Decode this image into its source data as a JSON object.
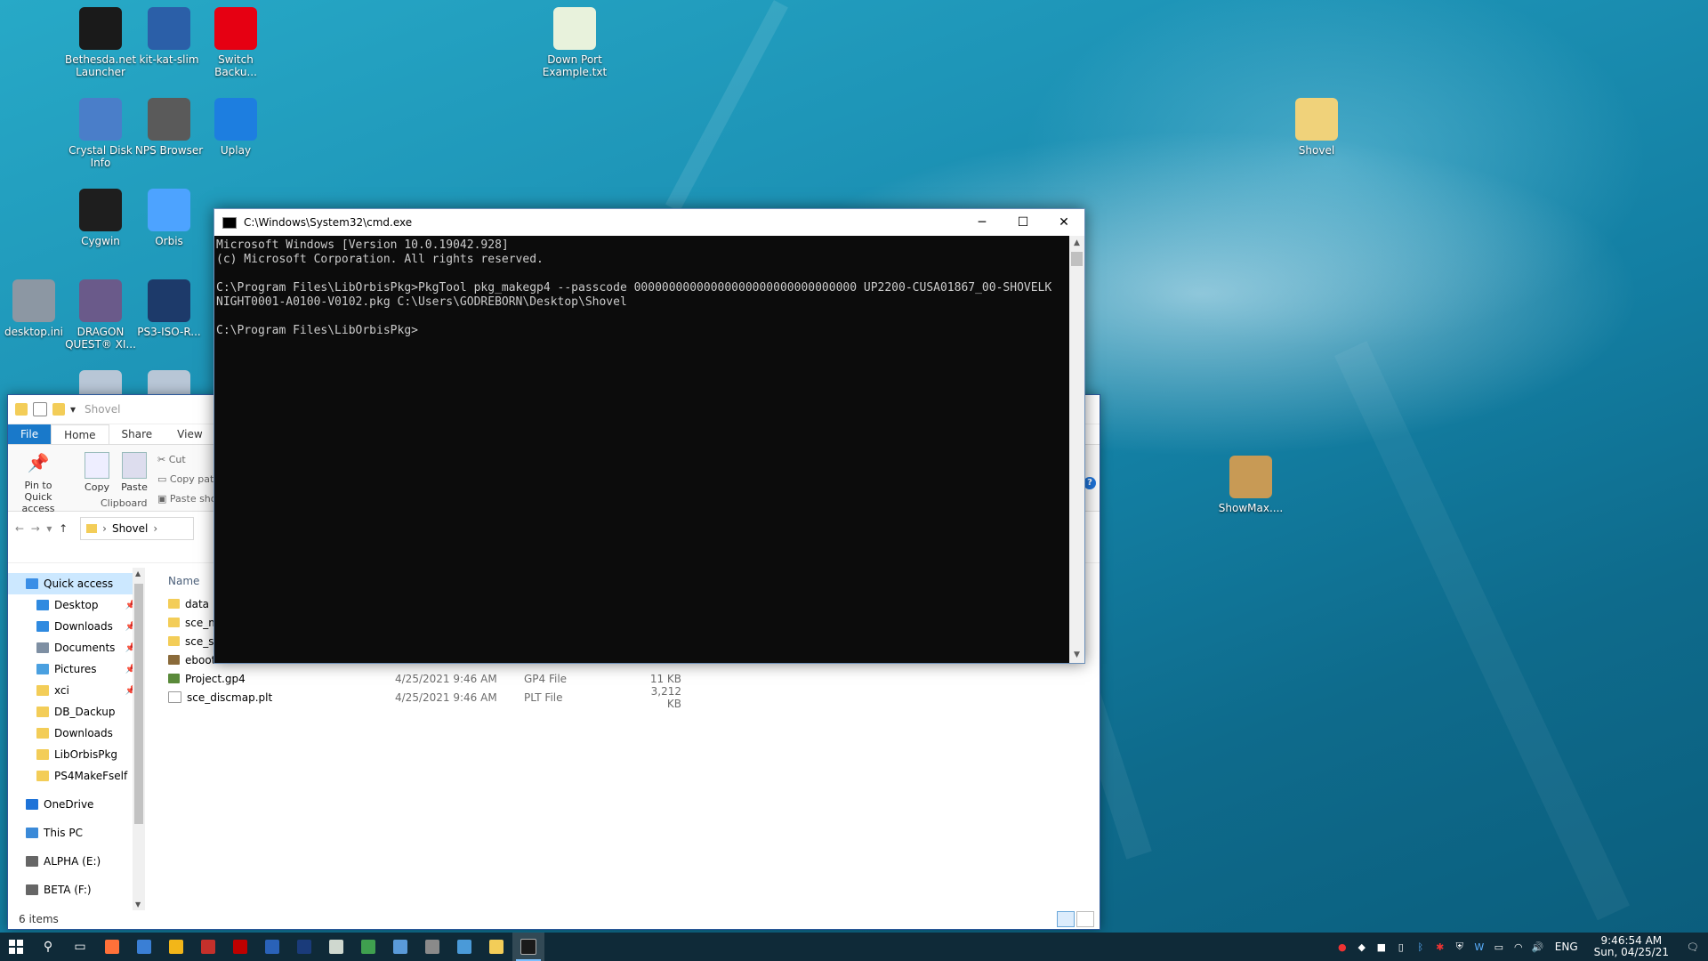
{
  "desktop": {
    "icons": [
      {
        "label": "Bethesda.net Launcher",
        "color": "#1a1a1a",
        "icon": "bethesda-icon"
      },
      {
        "label": "kit-kat-slim",
        "color": "#2b5fa8",
        "icon": "laptop-icon"
      },
      {
        "label": "Switch Backu...",
        "color": "#e60012",
        "icon": "switch-icon"
      },
      {
        "label": "Down Port Example.txt",
        "color": "#e8f2dc",
        "icon": "notepad-icon"
      },
      {
        "label": "Crystal Disk Info",
        "color": "#4a7ec9",
        "icon": "disk-icon"
      },
      {
        "label": "NPS Browser",
        "color": "#5a5a5a",
        "icon": "nps-icon"
      },
      {
        "label": "Uplay",
        "color": "#1d7ee0",
        "icon": "uplay-icon"
      },
      {
        "label": "Shovel",
        "color": "#f0d27a",
        "icon": "folder-icon"
      },
      {
        "label": "Cygwin",
        "color": "#1e1e1e",
        "icon": "cygwin-icon"
      },
      {
        "label": "Orbis",
        "color": "#4da3ff",
        "icon": "orbis-icon"
      },
      {
        "label": "desktop.ini",
        "color": "#8c97a3",
        "icon": "settings-file-icon"
      },
      {
        "label": "DRAGON QUEST® XI...",
        "color": "#6a5a8a",
        "icon": "game-icon"
      },
      {
        "label": "PS3-ISO-R...",
        "color": "#1d3a6a",
        "icon": "disc-icon"
      },
      {
        "label": "ShowMax....",
        "color": "#c89a55",
        "icon": "package-icon"
      }
    ]
  },
  "cmd": {
    "title": "C:\\Windows\\System32\\cmd.exe",
    "lines": [
      "Microsoft Windows [Version 10.0.19042.928]",
      "(c) Microsoft Corporation. All rights reserved.",
      "",
      "C:\\Program Files\\LibOrbisPkg>PkgTool pkg_makegp4 --passcode 00000000000000000000000000000000 UP2200-CUSA01867_00-SHOVELK",
      "NIGHT0001-A0100-V0102.pkg C:\\Users\\GODREBORN\\Desktop\\Shovel",
      "",
      "C:\\Program Files\\LibOrbisPkg>"
    ]
  },
  "explorer": {
    "title": "Shovel",
    "tabs": [
      "File",
      "Home",
      "Share",
      "View"
    ],
    "ribbon": {
      "pin": "Pin to Quick access",
      "copy": "Copy",
      "paste": "Paste",
      "cut": "Cut",
      "copy_path": "Copy path",
      "paste_shortcut": "Paste shor",
      "group": "Clipboard"
    },
    "breadcrumb": "Shovel",
    "column_name": "Name",
    "nav": [
      {
        "label": "Quick access",
        "color": "#3a8ee6",
        "pinned": false
      },
      {
        "label": "Desktop",
        "color": "#2f8ae0",
        "pinned": true
      },
      {
        "label": "Downloads",
        "color": "#2f8ae0",
        "pinned": true
      },
      {
        "label": "Documents",
        "color": "#7e8fa3",
        "pinned": true
      },
      {
        "label": "Pictures",
        "color": "#4aa0e0",
        "pinned": true
      },
      {
        "label": "xci",
        "color": "#f3cd58",
        "pinned": true
      },
      {
        "label": "DB_Dackup",
        "color": "#f3cd58",
        "pinned": false
      },
      {
        "label": "Downloads",
        "color": "#f3cd58",
        "pinned": false
      },
      {
        "label": "LibOrbisPkg",
        "color": "#f3cd58",
        "pinned": false
      },
      {
        "label": "PS4MakeFself",
        "color": "#f3cd58",
        "pinned": false
      },
      {
        "label": "OneDrive",
        "color": "#1e73d8",
        "pinned": false
      },
      {
        "label": "This PC",
        "color": "#3b8ad8",
        "pinned": false
      },
      {
        "label": "ALPHA (E:)",
        "color": "#666666",
        "pinned": false
      },
      {
        "label": "BETA (F:)",
        "color": "#666666",
        "pinned": false
      }
    ],
    "pin_glyph": "📌",
    "files": [
      {
        "name": "data",
        "date": "",
        "type": "",
        "size": "",
        "color": "#f3cd58"
      },
      {
        "name": "sce_mo",
        "date": "",
        "type": "",
        "size": "",
        "color": "#f3cd58"
      },
      {
        "name": "sce_sys",
        "date": "",
        "type": "",
        "size": "",
        "color": "#f3cd58"
      },
      {
        "name": "eboot.",
        "date": "",
        "type": "",
        "size": "",
        "color": "#8a6a3a"
      },
      {
        "name": "Project.gp4",
        "date": "4/25/2021 9:46 AM",
        "type": "GP4 File",
        "size": "11 KB",
        "color": "#5a8a3a"
      },
      {
        "name": "sce_discmap.plt",
        "date": "4/25/2021 9:46 AM",
        "type": "PLT File",
        "size": "3,212 KB",
        "color": "#ffffff"
      }
    ],
    "status": "6 items"
  },
  "taskbar": {
    "lang": "ENG",
    "time": "9:46:54 AM",
    "date": "Sun, 04/25/21",
    "apps": [
      {
        "name": "firefox",
        "color": "#ff7139"
      },
      {
        "name": "app2",
        "color": "#3a7fd5"
      },
      {
        "name": "chrome",
        "color": "#f2b619"
      },
      {
        "name": "app4",
        "color": "#c4302b"
      },
      {
        "name": "filezilla",
        "color": "#bf0000"
      },
      {
        "name": "app6",
        "color": "#2a62b8"
      },
      {
        "name": "photoshop",
        "color": "#1a3b7a"
      },
      {
        "name": "app8",
        "color": "#cfd8cf"
      },
      {
        "name": "app9",
        "color": "#3fa04f"
      },
      {
        "name": "app10",
        "color": "#5a9ad8"
      },
      {
        "name": "calc",
        "color": "#8a8a8a"
      },
      {
        "name": "app12",
        "color": "#4a9ad8"
      },
      {
        "name": "explorer",
        "color": "#f3cd58"
      },
      {
        "name": "cmd",
        "color": "#1a1a1a"
      }
    ]
  }
}
